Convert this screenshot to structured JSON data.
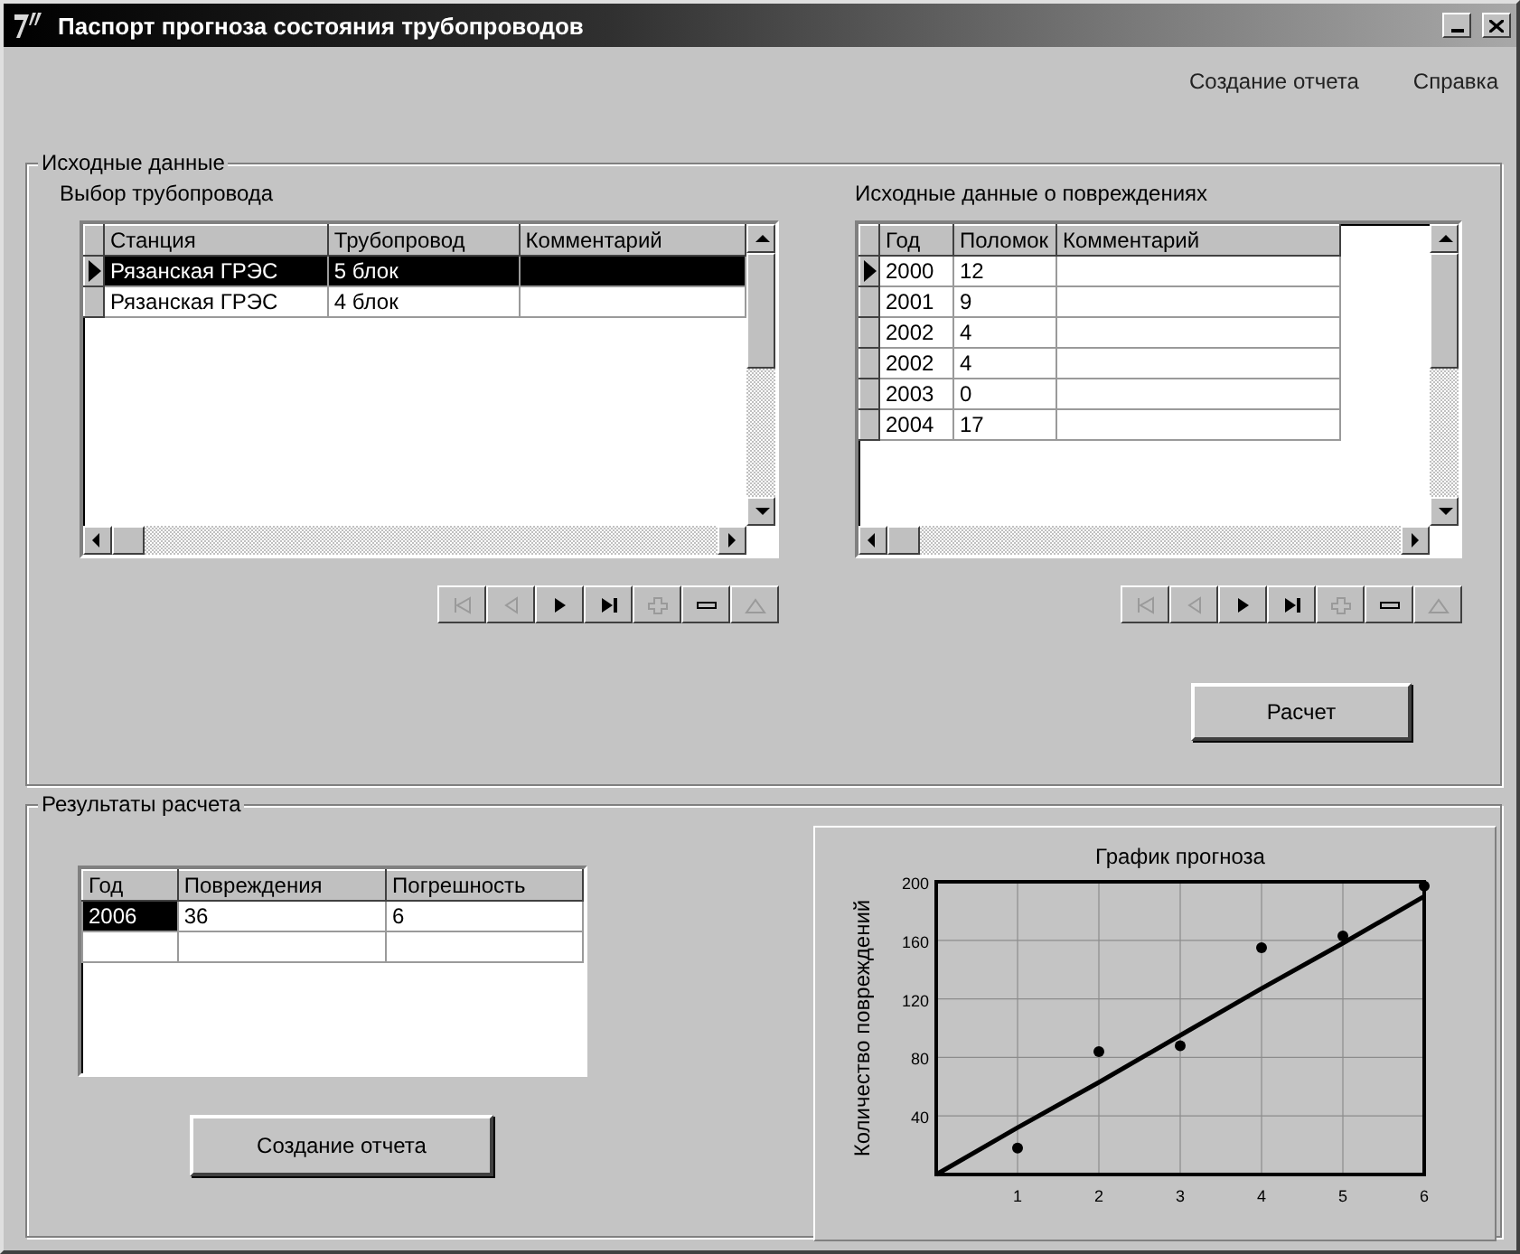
{
  "window": {
    "title": "Паспорт прогноза состояния трубопроводов"
  },
  "menu": [
    {
      "label": "Создание отчета"
    },
    {
      "label": "Справка"
    }
  ],
  "source_group": {
    "title": "Исходные данные",
    "pipeline": {
      "label": "Выбор трубопровода",
      "columns": [
        "Станция",
        "Трубопровод",
        "Комментарий"
      ],
      "rows": [
        {
          "cells": [
            "Рязанская ГРЭС",
            "5 блок",
            ""
          ],
          "selected": true,
          "current": true
        },
        {
          "cells": [
            "Рязанская ГРЭС",
            "4 блок",
            ""
          ],
          "selected": false,
          "current": false
        }
      ],
      "nav_buttons": [
        {
          "kind": "first",
          "disabled": true
        },
        {
          "kind": "prior",
          "disabled": true
        },
        {
          "kind": "next",
          "disabled": false
        },
        {
          "kind": "last",
          "disabled": false
        },
        {
          "kind": "insert",
          "disabled": true
        },
        {
          "kind": "delete",
          "disabled": false
        },
        {
          "kind": "edit",
          "disabled": true
        }
      ]
    },
    "damage": {
      "label": "Исходные данные о повреждениях",
      "columns": [
        "Год",
        "Поломок",
        "Комментарий"
      ],
      "rows": [
        {
          "cells": [
            "2000",
            "12",
            ""
          ],
          "selected": false,
          "current": true
        },
        {
          "cells": [
            "2001",
            "9",
            ""
          ],
          "selected": false,
          "current": false
        },
        {
          "cells": [
            "2002",
            "4",
            ""
          ],
          "selected": false,
          "current": false
        },
        {
          "cells": [
            "2002",
            "4",
            ""
          ],
          "selected": false,
          "current": false
        },
        {
          "cells": [
            "2003",
            "0",
            ""
          ],
          "selected": false,
          "current": false
        },
        {
          "cells": [
            "2004",
            "17",
            ""
          ],
          "selected": false,
          "current": false
        }
      ],
      "nav_buttons": [
        {
          "kind": "first",
          "disabled": true
        },
        {
          "kind": "prior",
          "disabled": true
        },
        {
          "kind": "next",
          "disabled": false
        },
        {
          "kind": "last",
          "disabled": false
        },
        {
          "kind": "insert",
          "disabled": true
        },
        {
          "kind": "delete",
          "disabled": false
        },
        {
          "kind": "edit",
          "disabled": true
        }
      ]
    },
    "calc_button": "Расчет"
  },
  "results_group": {
    "title": "Результаты расчета",
    "table": {
      "columns": [
        "Год",
        "Повреждения",
        "Погрешность"
      ],
      "rows": [
        {
          "cells": [
            "2006",
            "36",
            "6"
          ],
          "selected": true
        },
        {
          "cells": [
            "",
            "",
            ""
          ],
          "selected": false
        }
      ]
    },
    "report_button": "Создание отчета",
    "chart_data": {
      "type": "scatter",
      "title": "График прогноза",
      "ylabel": "Количество повреждений",
      "x": [
        0,
        1,
        2,
        3,
        4,
        5,
        6
      ],
      "xlim": [
        0,
        6
      ],
      "ylim": [
        0,
        200
      ],
      "xticks": [
        1,
        2,
        3,
        4,
        5,
        6
      ],
      "yticks": [
        40,
        80,
        120,
        160,
        200
      ],
      "grid": true,
      "series": [
        {
          "color": "#000000",
          "values": [
            null,
            18,
            84,
            88,
            155,
            163,
            197
          ]
        },
        {
          "type": "line",
          "color": "#000000",
          "values": [
            0,
            32,
            63,
            95,
            127,
            158,
            190
          ]
        }
      ]
    }
  }
}
